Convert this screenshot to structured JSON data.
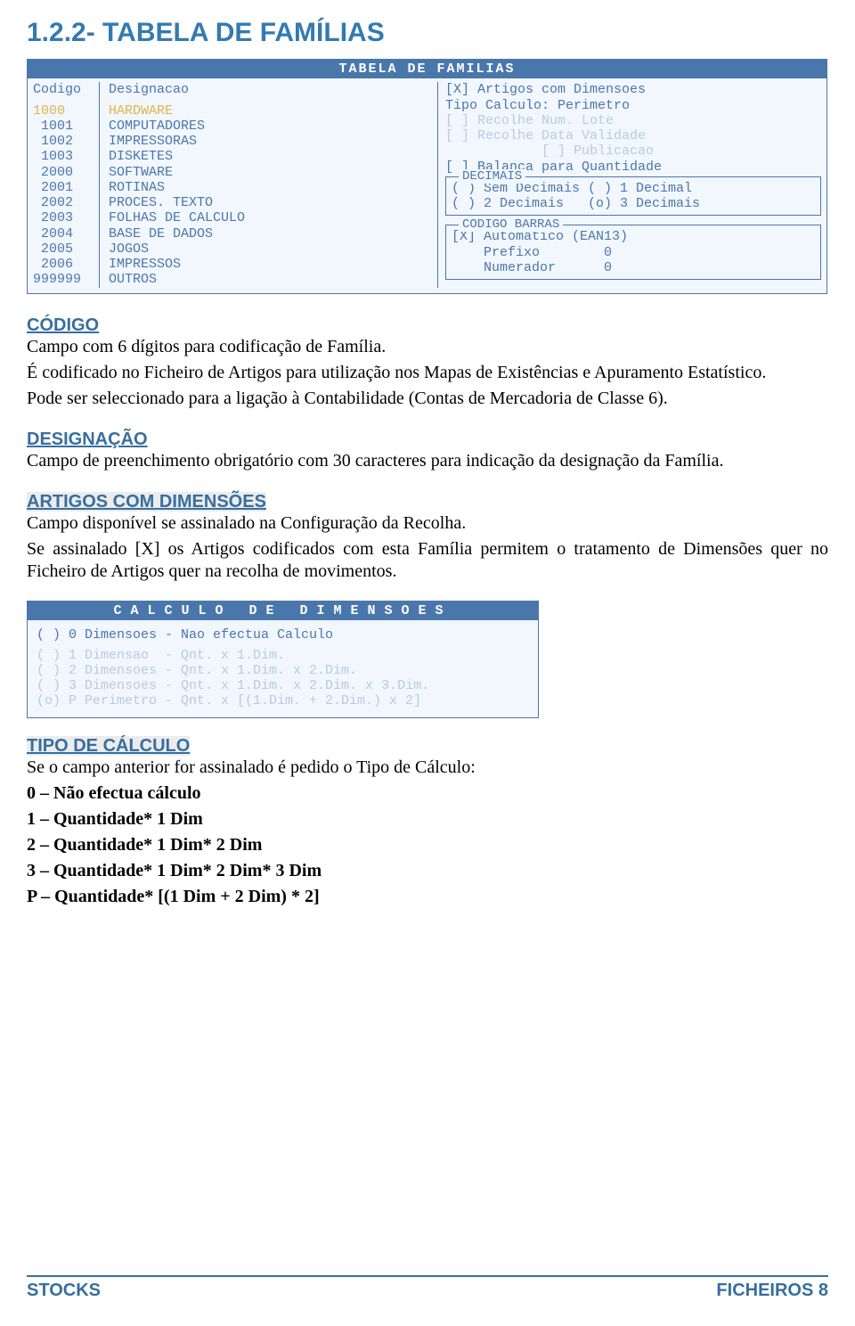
{
  "title": "1.2.2- TABELA DE FAMÍLIAS",
  "app1": {
    "title": "TABELA DE FAMILIAS",
    "head_codigo": "Codigo",
    "head_desig": "Designacao",
    "rows": [
      {
        "codigo": "1000",
        "desig": "HARDWARE",
        "selected": true
      },
      {
        "codigo": " 1001",
        "desig": "COMPUTADORES"
      },
      {
        "codigo": " 1002",
        "desig": "IMPRESSORAS"
      },
      {
        "codigo": " 1003",
        "desig": "DISKETES"
      },
      {
        "codigo": " 2000",
        "desig": "SOFTWARE"
      },
      {
        "codigo": " 2001",
        "desig": "ROTINAS"
      },
      {
        "codigo": " 2002",
        "desig": "PROCES. TEXTO"
      },
      {
        "codigo": " 2003",
        "desig": "FOLHAS DE CALCULO"
      },
      {
        "codigo": " 2004",
        "desig": "BASE DE DADOS"
      },
      {
        "codigo": " 2005",
        "desig": "JOGOS"
      },
      {
        "codigo": " 2006",
        "desig": "IMPRESSOS"
      },
      {
        "codigo": "999999",
        "desig": "OUTROS"
      }
    ],
    "rp": {
      "artigos_dim": "[X] Artigos com Dimensoes",
      "tipo_calculo": "Tipo Calculo: Perimetro",
      "recolhe_lote": "[ ] Recolhe Num. Lote",
      "recolhe_data": "[ ] Recolhe Data Validade",
      "publicacao": "            [ ] Publicacao",
      "balanca": "[ ] Balanca para Quantidade",
      "decimais_label": "DECIMAIS",
      "dec1": "( ) Sem Decimais ( ) 1 Decimal",
      "dec2": "( ) 2 Decimais   (o) 3 Decimais",
      "barras_label": "CODIGO BARRAS",
      "bar1": "[X] Automatico (EAN13)",
      "bar2": "    Prefixo        0",
      "bar3": "    Numerador      0"
    }
  },
  "sections": {
    "codigo_head": "CÓDIGO",
    "codigo_p1": "Campo com 6 dígitos para codificação de Família.",
    "codigo_p2": "É codificado no Ficheiro de Artigos para utilização nos Mapas de Existências e Apuramento Estatístico.",
    "codigo_p3": "Pode ser seleccionado para a ligação à Contabilidade (Contas de Mercadoria de Classe 6).",
    "desig_head": "DESIGNAÇÃO",
    "desig_p1": "Campo de preenchimento obrigatório com 30 caracteres para indicação da designação da Família.",
    "artdim_head": "ARTIGOS COM DIMENSÕES",
    "artdim_p1": "Campo disponível se assinalado na Configuração da Recolha.",
    "artdim_p2": "Se assinalado [X] os Artigos codificados com esta Família permitem o tratamento de Dimensões quer no Ficheiro de Artigos quer na recolha de movimentos.",
    "tipocalc_head": "TIPO DE CÁLCULO",
    "tipocalc_p1": "Se o campo anterior for assinalado é pedido o Tipo de Cálculo:",
    "tipocalc_l0": "0 – Não efectua cálculo",
    "tipocalc_l1": "1 – Quantidade* 1 Dim",
    "tipocalc_l2": "2 – Quantidade* 1 Dim* 2 Dim",
    "tipocalc_l3": "3 – Quantidade* 1 Dim* 2 Dim* 3 Dim",
    "tipocalc_lp": "P – Quantidade* [(1 Dim + 2 Dim) * 2]"
  },
  "app2": {
    "title": "CALCULO   DE   DIMENSOES",
    "rows": [
      {
        "t": "( ) 0 Dimensoes - Nao efectua Calculo",
        "dim": false
      },
      {
        "t": "( ) 1 Dimensao  - Qnt. x 1.Dim.",
        "dim": true
      },
      {
        "t": "( ) 2 Dimensoes - Qnt. x 1.Dim. x 2.Dim.",
        "dim": true
      },
      {
        "t": "( ) 3 Dimensoes - Qnt. x 1.Dim. x 2.Dim. x 3.Dim.",
        "dim": true
      },
      {
        "t": "(o) P Perimetro - Qnt. x [(1.Dim. + 2.Dim.) x 2]",
        "dim": true
      }
    ]
  },
  "footer": {
    "left": "STOCKS",
    "right": "FICHEIROS    8"
  }
}
